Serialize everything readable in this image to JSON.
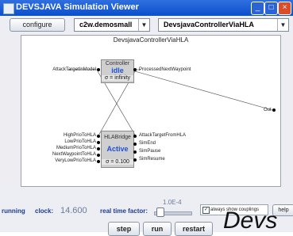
{
  "window": {
    "title": "DEVSJAVA Simulation Viewer",
    "controls": [
      "_",
      "□",
      "×"
    ]
  },
  "toolbar": {
    "configure_label": "configure",
    "package_value": "c2w.demosmall",
    "model_value": "DevsjavaControllerViaHLA",
    "dropdown_arrow": "▼"
  },
  "canvas": {
    "title": "DevsjavaControllerViaHLA",
    "controller": {
      "name": "Controller",
      "phase": "idle",
      "sigma": "σ = infinity",
      "inputs": [
        "AttackTargetInModel"
      ],
      "outputs": [
        "ProcessedNextWaypoint"
      ]
    },
    "bridge": {
      "name": "HLABridge",
      "phase": "Active",
      "sigma": "σ = 0.100",
      "inputs": [
        "HighPrioToHLA",
        "LowPrioToHLA",
        "MediumPrioToHLA",
        "NextWaypointToHLA",
        "VeryLowPrioToHLA"
      ],
      "outputs": [
        "AttackTargetFromHLA",
        "SimEnd",
        "SimPause",
        "SimResume"
      ]
    },
    "out_port": "Out"
  },
  "status": {
    "state": "running",
    "clock_label": "clock:",
    "clock_value": "14.600",
    "rtf_label": "real time factor:",
    "rtf_value": "1.0E-4",
    "always_show_label": "always show couplings",
    "help_label": "help",
    "step_label": "step",
    "run_label": "run",
    "restart_label": "restart"
  },
  "brand_text": "Devs"
}
